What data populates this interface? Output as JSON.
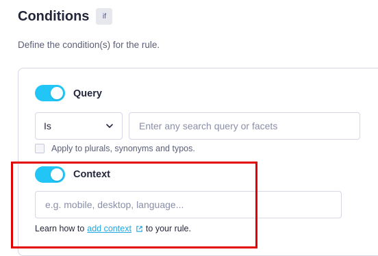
{
  "header": {
    "title": "Conditions",
    "badge": "if",
    "subtitle": "Define the condition(s) for the rule."
  },
  "query": {
    "toggle_label": "Query",
    "toggle_on": true,
    "operator_value": "Is",
    "input_placeholder": "Enter any search query or facets",
    "checkbox_label": "Apply to plurals, synonyms and typos.",
    "checkbox_checked": false
  },
  "context": {
    "toggle_label": "Context",
    "toggle_on": true,
    "input_placeholder": "e.g. mobile, desktop, language...",
    "help_prefix": "Learn how to",
    "help_link": "add context",
    "help_suffix": "to your rule."
  },
  "colors": {
    "accent": "#21c5f6",
    "link": "#21a6e3",
    "highlight": "#e30000"
  }
}
